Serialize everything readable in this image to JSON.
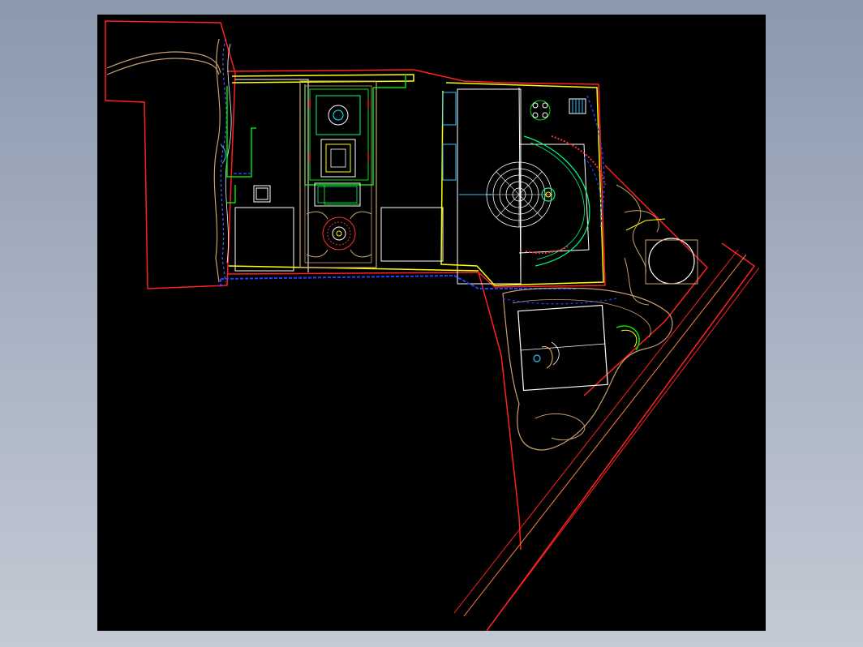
{
  "drawing": {
    "colors": {
      "background": "#000000",
      "boundary": "#ff2020",
      "walk": "#ffff00",
      "hedge": "#00e000",
      "paving": "#c8a070",
      "utility": "#2040ff",
      "linework": "#ffffff",
      "water": "#30c0ff",
      "accent": "#ff3030",
      "court_mark": "#ffc050"
    }
  }
}
